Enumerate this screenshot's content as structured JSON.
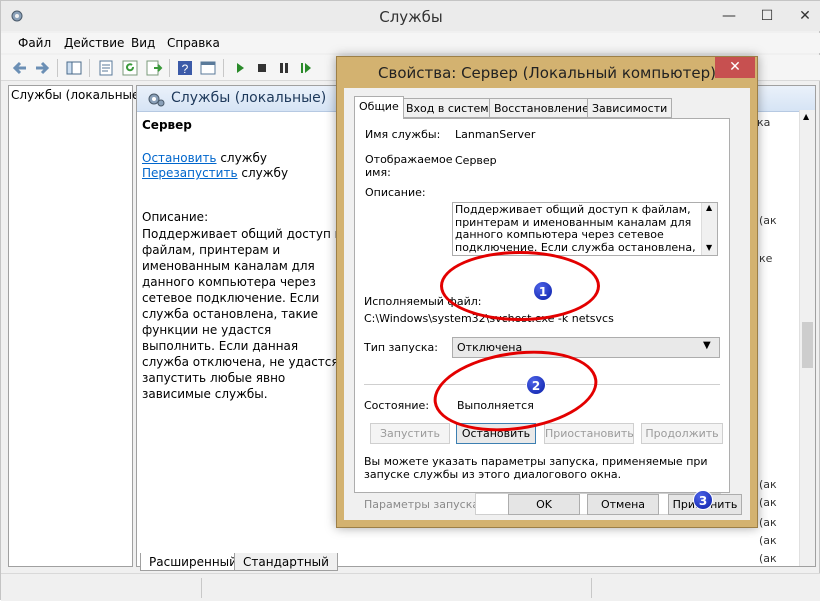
{
  "main": {
    "title": "Службы",
    "menu": [
      "Файл",
      "Действие",
      "Вид",
      "Справка"
    ],
    "tree_root": "Службы (локальные)",
    "pane_title": "Службы (локальные)",
    "service_name": "Сервер",
    "stop_link": "Остановить",
    "stop_suffix": " службу",
    "restart_link": "Перезапустить",
    "restart_suffix": " службу",
    "description_label": "Описание:",
    "description": "Поддерживает общий доступ к файлам, принтерам и именованным каналам для данного компьютера через сетевое подключение. Если служба остановлена, такие функции не удастся выполнить. Если данная служба отключена, не удастся запустить любые явно зависимые службы.",
    "column_fragment": "ка",
    "right_fragments": [
      "(ак",
      "ке",
      "(ак",
      "(ак",
      "(ак",
      "(ак",
      "(ак"
    ],
    "tabs_bottom": [
      "Расширенный",
      "Стандартный"
    ]
  },
  "dialog": {
    "title": "Свойства: Сервер (Локальный компьютер)",
    "close": "✕",
    "tabs": [
      "Общие",
      "Вход в систему",
      "Восстановление",
      "Зависимости"
    ],
    "service_name_label": "Имя службы:",
    "service_name_value": "LanmanServer",
    "display_name_label": "Отображаемое имя:",
    "display_name_value": "Сервер",
    "description_label": "Описание:",
    "description_value": "Поддерживает общий доступ к файлам, принтерам и именованным каналам для данного компьютера через сетевое подключение. Если служба остановлена, такие",
    "exe_label": "Исполняемый файл:",
    "exe_value": "C:\\Windows\\system32\\svchost.exe -k netsvcs",
    "startup_type_label": "Тип запуска:",
    "startup_type_value": "Отключена",
    "status_label": "Состояние:",
    "status_value": "Выполняется",
    "btn_start": "Запустить",
    "btn_stop": "Остановить",
    "btn_pause": "Приостановить",
    "btn_resume": "Продолжить",
    "hint": "Вы можете указать параметры запуска, применяемые при запуске службы из этого диалогового окна.",
    "params_label": "Параметры запуска:",
    "params_value": "",
    "btn_ok": "OK",
    "btn_cancel": "Отмена",
    "btn_apply": "Применить"
  },
  "annotations": {
    "badge1": "1",
    "badge2": "2",
    "badge3": "3",
    "color": "#e30000",
    "badge_color": "#1a2fcf"
  },
  "colors": {
    "dialog_frame": "#d3b270",
    "link": "#0066cc",
    "close_button": "#c75050"
  }
}
